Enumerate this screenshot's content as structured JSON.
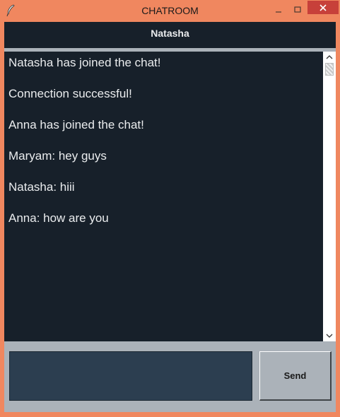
{
  "window": {
    "title": "CHATROOM",
    "icon": "feather-icon",
    "accent_color": "#f0875f",
    "close_color": "#c7403a"
  },
  "header": {
    "title": "Natasha",
    "background": "#17202a"
  },
  "chat": {
    "messages": [
      "Natasha has joined the chat!",
      "Connection successful!",
      "Anna has joined the chat!",
      "Maryam: hey guys",
      "Natasha: hiii",
      "Anna: how are you"
    ]
  },
  "composer": {
    "input_value": "",
    "input_background": "#2c3e50",
    "send_label": "Send"
  }
}
